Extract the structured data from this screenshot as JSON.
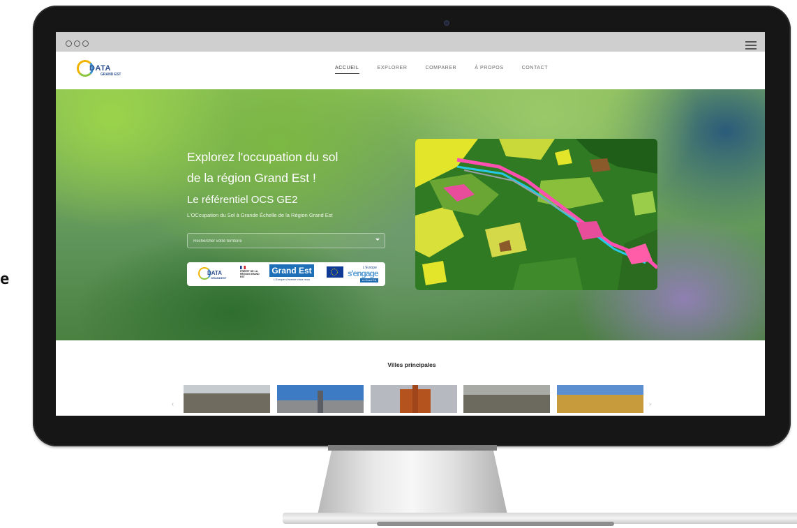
{
  "browser": {
    "menu_icon": "hamburger-icon"
  },
  "logo": {
    "word": "DATA",
    "sub": "GRAND EST"
  },
  "nav": {
    "items": [
      {
        "label": "ACCUEIL",
        "active": true
      },
      {
        "label": "EXPLORER",
        "active": false
      },
      {
        "label": "COMPARER",
        "active": false
      },
      {
        "label": "À PROPOS",
        "active": false
      },
      {
        "label": "CONTACT",
        "active": false
      }
    ]
  },
  "hero": {
    "title_line1": "Explorez l'occupation du sol",
    "title_line2": "de la région Grand Est !",
    "subtitle": "Le référentiel OCS GE2",
    "description": "L'OCcupation du Sol à Grande Échelle de la Région Grand Est",
    "search_placeholder": "Rechercher votre territoire"
  },
  "partners": {
    "data_word": "DATA",
    "data_sub": "GRANDEST",
    "prefet": "PRÉFET DE LA RÉGION GRAND EST",
    "grand_est": "Grand Est",
    "grand_est_tagline": "L'Europe s'invente chez nous",
    "europe_big": "s'engage",
    "europe_small": "L'Europe",
    "europe_bar": "en Grand Est"
  },
  "cities": {
    "title": "Villes principales",
    "prev": "‹",
    "next": "›"
  },
  "colors": {
    "nav_text": "#666666",
    "hero_text": "#ffffff",
    "grand_est_blue": "#1d6fb8",
    "monitor": "#161616"
  },
  "stray_glyph": "e"
}
